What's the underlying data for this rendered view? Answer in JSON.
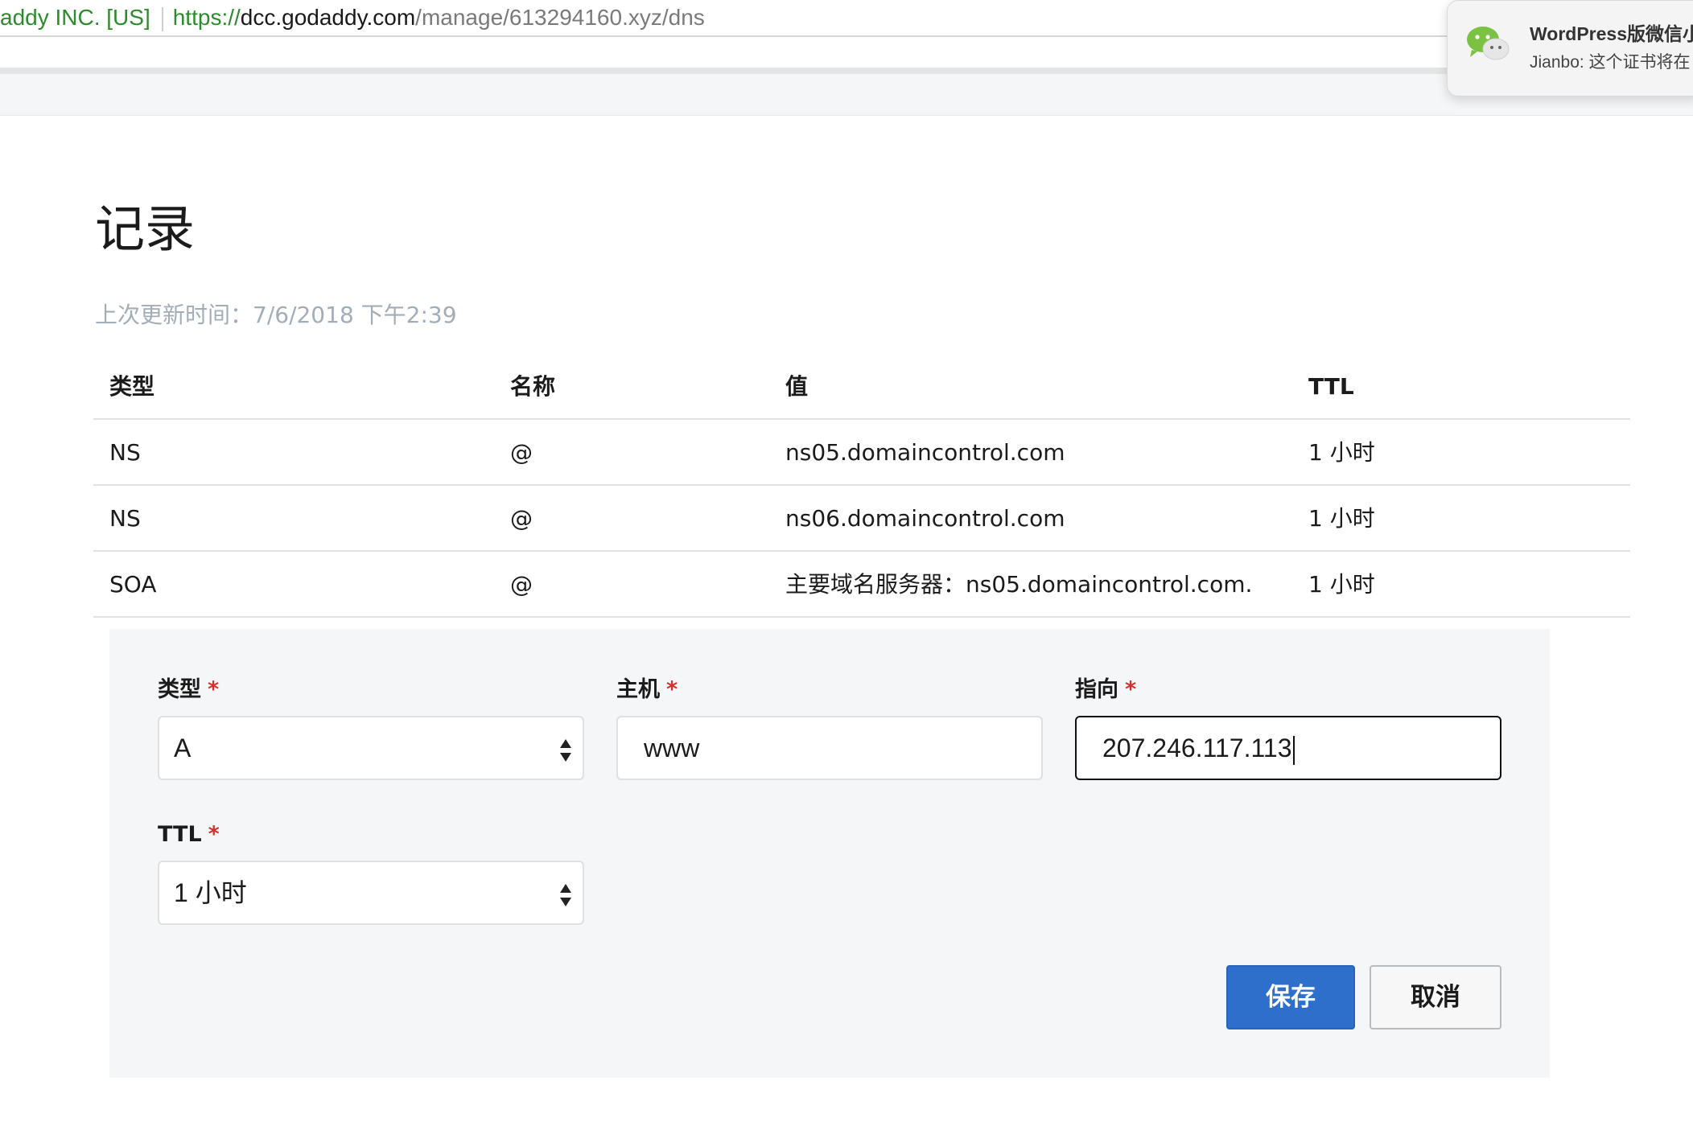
{
  "browser": {
    "cert_org": "addy INC. [US]",
    "url_scheme": "https://",
    "url_host": "dcc.godaddy.com",
    "url_path": "/manage/613294160.xyz/dns"
  },
  "notification": {
    "app_icon": "wechat-icon",
    "title": "WordPress版微信小",
    "body": "Jianbo: 这个证书将在"
  },
  "page": {
    "title": "记录",
    "last_updated": "上次更新时间：7/6/2018 下午2:39"
  },
  "table": {
    "headers": [
      "类型",
      "名称",
      "值",
      "TTL"
    ],
    "rows": [
      [
        "NS",
        "@",
        "ns05.domaincontrol.com",
        "1 小时"
      ],
      [
        "NS",
        "@",
        "ns06.domaincontrol.com",
        "1 小时"
      ],
      [
        "SOA",
        "@",
        "主要域名服务器：ns05.domaincontrol.com.",
        "1 小时"
      ]
    ]
  },
  "form": {
    "type_label": "类型",
    "type_value": "A",
    "host_label": "主机",
    "host_value": "www",
    "points_to_label": "指向",
    "points_to_value": "207.246.117.113",
    "ttl_label": "TTL",
    "ttl_value": "1 小时",
    "required_mark": "*",
    "save_label": "保存",
    "cancel_label": "取消"
  },
  "colors": {
    "primary": "#2f6fcc",
    "required": "#d62d2d",
    "muted_text": "#a3adb7",
    "panel_bg": "#f5f6f7",
    "secure_green": "#2d8a2d"
  }
}
